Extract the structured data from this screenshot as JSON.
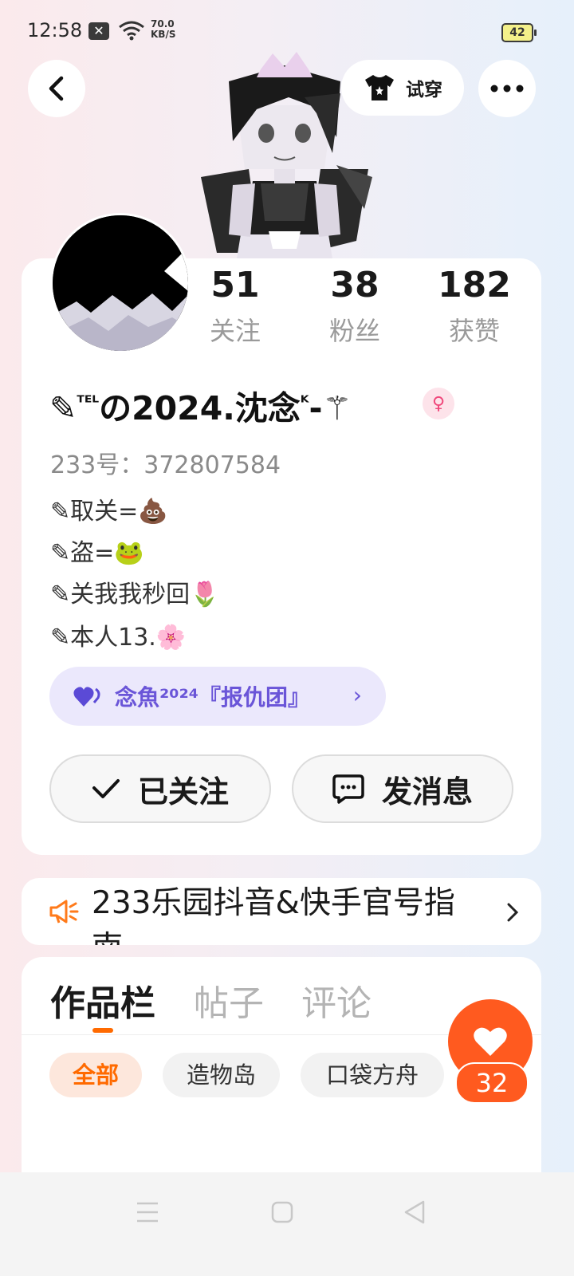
{
  "status_bar": {
    "time": "12:58",
    "x_badge": "✕",
    "net_speed_value": "70.0",
    "net_speed_unit": "KB/S",
    "battery": "42"
  },
  "header": {
    "try_on_label": "试穿"
  },
  "stats": [
    {
      "value": "51",
      "label": "关注"
    },
    {
      "value": "38",
      "label": "粉丝"
    },
    {
      "value": "182",
      "label": "获赞"
    }
  ],
  "profile": {
    "nickname_prefix": "✎",
    "nickname_sup": "ᵀᴱᴸ",
    "nickname_main": "の2024.沈念",
    "nickname_sup2": "ᴷ",
    "nickname_suffix": "-⚚",
    "gender_symbol": "♀",
    "uid": "233号：372807584",
    "bio": [
      "✎取关=💩",
      "✎盗=🐸",
      "✎关我我秒回🌷",
      "✎本人13.🌸"
    ]
  },
  "group": {
    "name": "念魚²⁰²⁴『报仇团』",
    "chevron": "›"
  },
  "actions": {
    "followed_label": "已关注",
    "message_label": "发消息"
  },
  "notice": {
    "text_line1": "233乐园抖音&快手官号指",
    "text_line2": "南"
  },
  "works": {
    "tabs": [
      "作品栏",
      "帖子",
      "评论"
    ],
    "chips": [
      "全部",
      "造物岛",
      "口袋方舟"
    ],
    "like_count": "32"
  },
  "colors": {
    "accent": "#ff6a00",
    "like": "#ff5a1f",
    "group": "#6a55d8"
  }
}
